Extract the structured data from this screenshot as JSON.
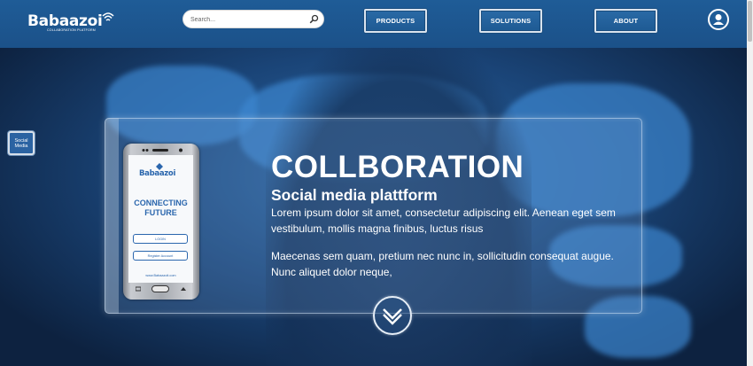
{
  "header": {
    "logo_text": "Babaazoi",
    "logo_subtitle": "COLLABORATION PLATFORM",
    "search_placeholder": "Search...",
    "nav": [
      "PRODUCTS",
      "SOLUTIONS",
      "ABOUT"
    ]
  },
  "side_badge": {
    "line1": "Social",
    "line2": "Media"
  },
  "phone": {
    "logo_text": "Babaazoi",
    "tagline_line1": "CONNECTING",
    "tagline_line2": "FUTURE",
    "login_label": "LOGIN",
    "register_label": "Register Account",
    "url": "www.Babaazoit.com"
  },
  "hero": {
    "title": "COLLBORATION",
    "subtitle": "Social media plattform",
    "paragraph1": "Lorem ipsum dolor sit amet, consectetur adipiscing elit. Aenean eget sem vestibulum, mollis magna finibus, luctus risus",
    "paragraph2": "Maecenas sem quam, pretium nec nunc in, sollicitudin consequat augue. Nunc aliquet dolor neque,"
  },
  "colors": {
    "header_blue": "#1f5c97",
    "brand_blue": "#2a66ad",
    "hero_dark": "#0d2240"
  },
  "icons": [
    "wifi-mark-icon",
    "search-icon",
    "user-icon",
    "chevron-down-icon"
  ]
}
